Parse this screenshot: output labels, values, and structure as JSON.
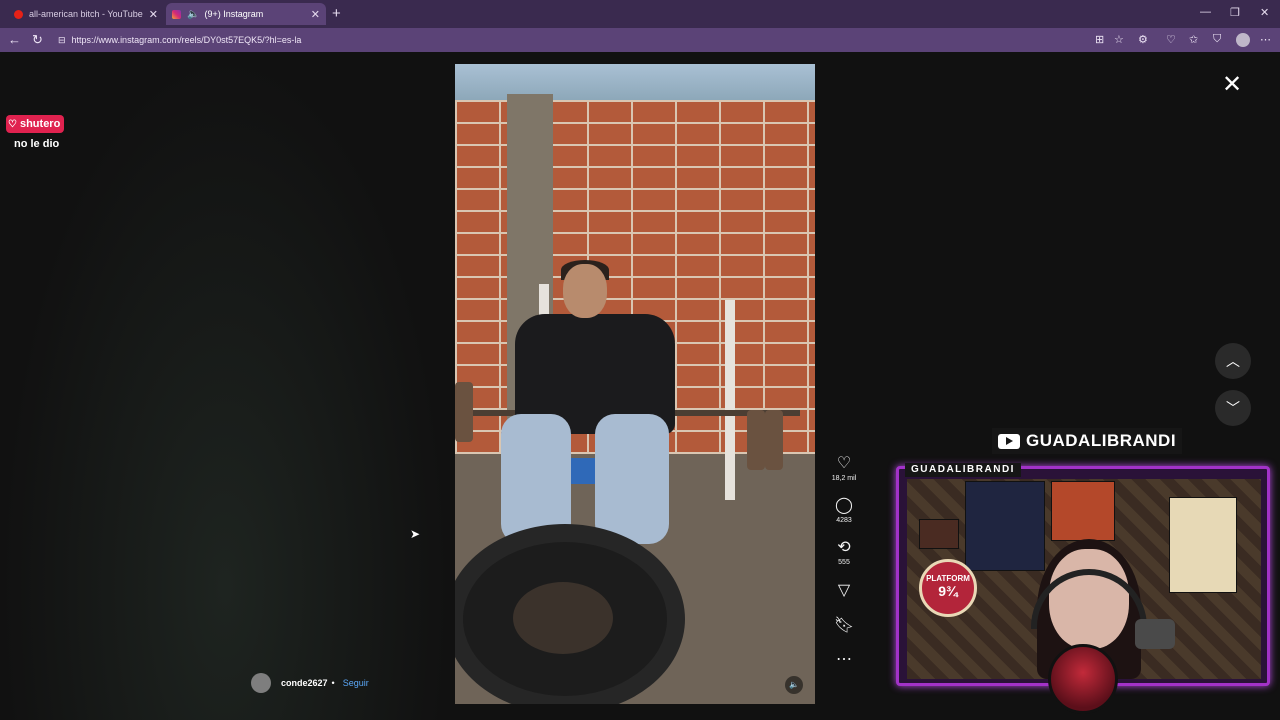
{
  "browser": {
    "tabs": [
      {
        "title": "all-american bitch - YouTube",
        "active": false
      },
      {
        "title": "(9+) Instagram",
        "active": true
      }
    ],
    "url": "https://www.instagram.com/reels/DY0st57EQK5/?hl=es-la"
  },
  "reel": {
    "author": "conde2627",
    "separator": "•",
    "follow_label": "Seguir",
    "likes": "18,2 mil",
    "comments": "4283",
    "reposts": "555"
  },
  "chat": {
    "username": "shutero",
    "message": "no le dio"
  },
  "stream": {
    "channel_name": "GUADALIBRANDI",
    "cam_label": "GUADALIBRANDI",
    "poster_text": "PLATFORM",
    "poster_number": "9¾"
  },
  "colors": {
    "browser_frame": "#3a2a4f",
    "browser_toolbar": "#5b4377",
    "instagram_follow": "#5aa6f5",
    "chat_badge": "#e0224f",
    "cam_border": "#a232c8"
  }
}
